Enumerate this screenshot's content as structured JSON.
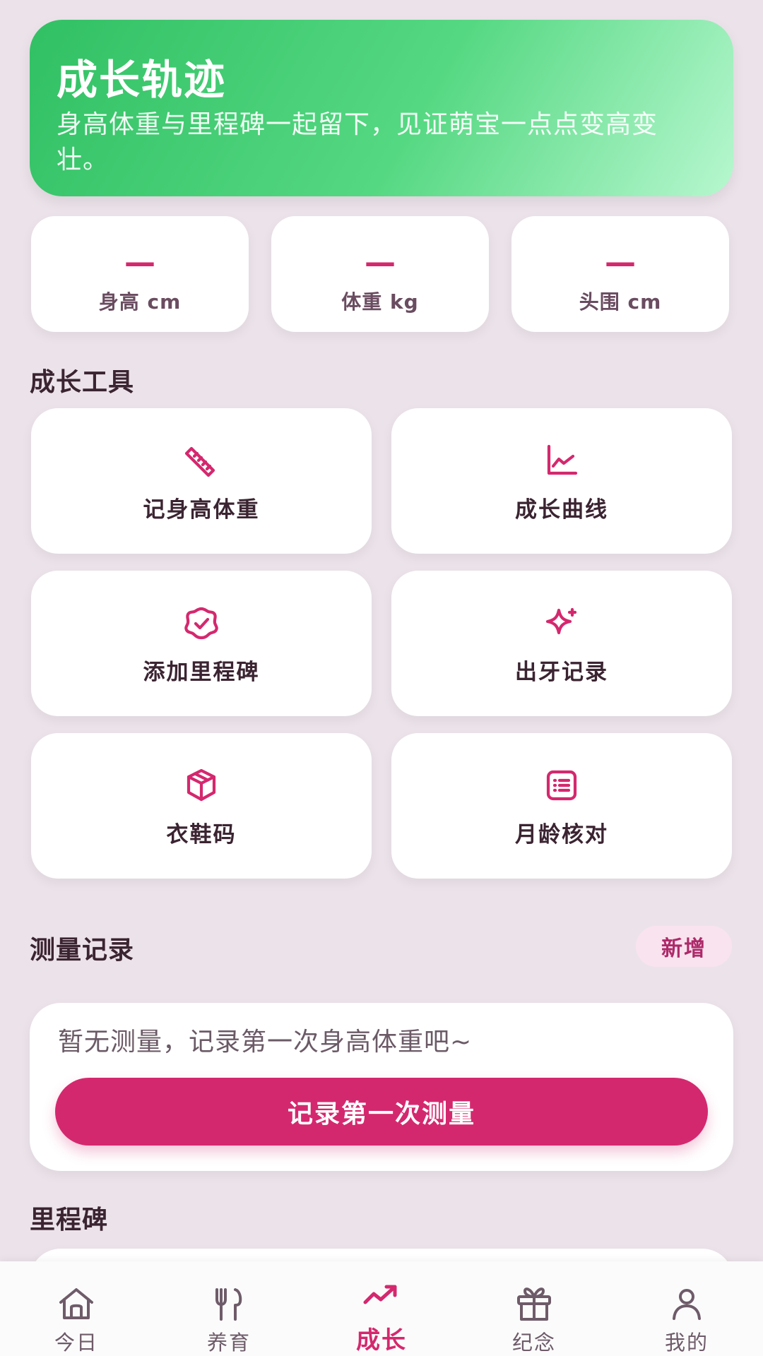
{
  "hero": {
    "title": "成长轨迹",
    "subtitle": "身高体重与里程碑一起留下，见证萌宝一点点变高变壮。"
  },
  "stats": [
    {
      "value": "—",
      "label": "身高 cm"
    },
    {
      "value": "—",
      "label": "体重 kg"
    },
    {
      "value": "—",
      "label": "头围 cm"
    }
  ],
  "sections": {
    "tools_title": "成长工具",
    "records_title": "测量记录",
    "milestones_title": "里程碑"
  },
  "tools": [
    {
      "label": "记身高体重",
      "icon": "ruler-icon"
    },
    {
      "label": "成长曲线",
      "icon": "growth-chart-icon"
    },
    {
      "label": "添加里程碑",
      "icon": "badge-check-icon"
    },
    {
      "label": "出牙记录",
      "icon": "sparkle-icon"
    },
    {
      "label": "衣鞋码",
      "icon": "box-icon"
    },
    {
      "label": "月龄核对",
      "icon": "calendar-list-icon"
    }
  ],
  "records": {
    "new_button": "新增",
    "empty_text": "暂无测量，记录第一次身高体重吧~",
    "primary_button": "记录第一次测量"
  },
  "bottom_nav": {
    "items": [
      {
        "label": "今日",
        "icon": "home-icon"
      },
      {
        "label": "养育",
        "icon": "fork-spoon-icon"
      },
      {
        "label": "成长",
        "icon": "trending-up-icon"
      },
      {
        "label": "纪念",
        "icon": "gift-icon"
      },
      {
        "label": "我的",
        "icon": "user-icon"
      }
    ],
    "active_index": 2
  },
  "colors": {
    "accent": "#d4286e",
    "background": "#ece3ea",
    "hero_start": "#31c064",
    "hero_end": "#b7f7cf"
  }
}
